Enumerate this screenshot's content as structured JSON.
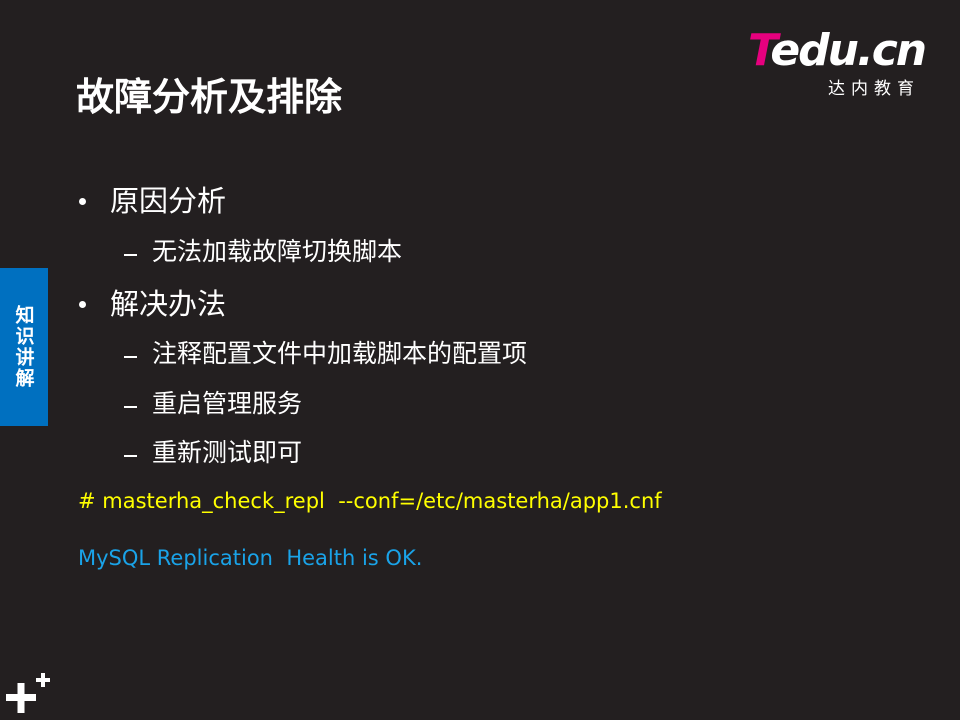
{
  "logo": {
    "brand_t": "T",
    "brand_rest": "edu.cn",
    "subtitle": "达内教育"
  },
  "slide": {
    "title": "故障分析及排除",
    "side_tab": "知识讲解",
    "items": [
      {
        "level": 1,
        "text": "原因分析"
      },
      {
        "level": 2,
        "text": "无法加载故障切换脚本"
      },
      {
        "level": 1,
        "text": "解决办法"
      },
      {
        "level": 2,
        "text": "注释配置文件中加载脚本的配置项"
      },
      {
        "level": 2,
        "text": "重启管理服务"
      },
      {
        "level": 2,
        "text": "重新测试即可"
      }
    ],
    "command": "# masterha_check_repl  --conf=/etc/masterha/app1.cnf",
    "result": "MySQL Replication  Health is OK."
  },
  "colors": {
    "background": "#231f20",
    "accent_blue": "#0070c0",
    "command": "#ffff00",
    "result": "#1aa3e8",
    "brand_pink": "#e6007e"
  }
}
